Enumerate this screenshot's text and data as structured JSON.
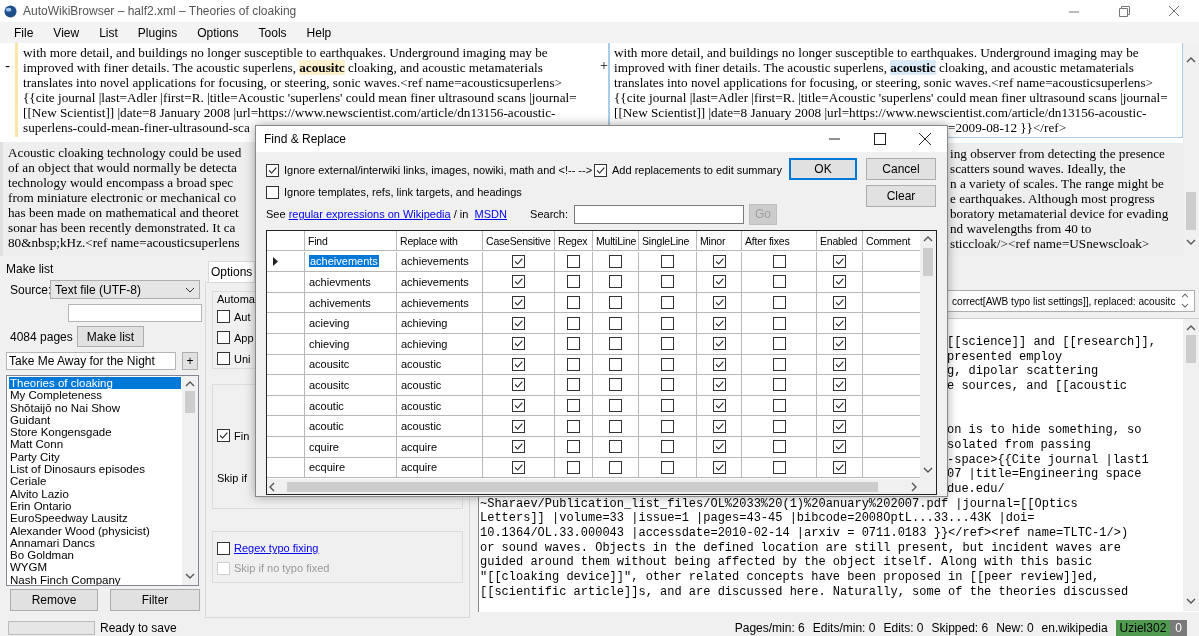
{
  "window": {
    "title": "AutoWikiBrowser – half2.xml – Theories of cloaking"
  },
  "menu": [
    "File",
    "View",
    "List",
    "Plugins",
    "Options",
    "Tools",
    "Help"
  ],
  "diff": {
    "columns": [
      {
        "kind": "removed",
        "marker": "-",
        "changed": {
          "lines": [
            "with more detail, and buildings no longer susceptible to earthquakes. Underground imaging may be",
            "improved with finer details. The acoustic superlens, **acousitc** cloaking, and acoustic metamaterials",
            "translates into novel applications for focusing, or steering, sonic waves.<ref name=acousticsuperlens>",
            "{{cite journal |last=Adler |first=R. |title=Acoustic 'superlens' could mean finer ultrasound scans |journal=",
            "[[New Scientist]] |date=8 January 2008 |url=https://www.newscientist.com/article/dn13156-acoustic-",
            "superlens-could-mean-finer-ultrasound-sca"
          ]
        },
        "context": {
          "lines": [
            "Acoustic cloaking technology could be used",
            "of an object that would normally be detecta",
            "technology would encompass a broad spec",
            "from miniature electronic or mechanical co",
            "has been made on mathematical and theoret",
            "sonar has been recently demonstrated. It ca",
            "80&nbsp;kHz.<ref name=acousticsuperlens"
          ]
        }
      },
      {
        "kind": "added",
        "marker": "+",
        "changed": {
          "lines": [
            "with more detail, and buildings no longer susceptible to earthquakes. Underground imaging may be",
            "improved with finer details. The acoustic superlens, **acoustic** cloaking, and acoustic metamaterials",
            "translates into novel applications for focusing, or steering, sonic waves.<ref name=acousticsuperlens>",
            "{{cite journal |last=Adler |first=R. |title=Acoustic 'superlens' could mean finer ultrasound scans |journal=",
            "[[New Scientist]] |date=8 January 2008 |url=https://www.newscientist.com/article/dn13156-acoustic-"
          ],
          "tail_lines": [
            "=2009-08-12 }}</ref>"
          ]
        },
        "context": {
          "tail_lines": [
            "ing observer from detecting the presence",
            "scatters sound waves. Ideally, the",
            "n a variety of scales. The range might be",
            "e earthquakes. Although most progress",
            "boratory metamaterial device for evading",
            "nd wavelengths from 40 to",
            "sticcloak/><ref name=USnewscloak>"
          ]
        }
      }
    ]
  },
  "make_list": {
    "title": "Make list",
    "source_label": "Source:",
    "source": "Text file (UTF-8)",
    "page_count": "4084 pages",
    "make_button": "Make list",
    "entry": "Take Me Away for the Night",
    "add_button": "+",
    "pages": [
      {
        "title": "Theories of cloaking",
        "selected": true
      },
      {
        "title": "My Completeness",
        "selected": false
      },
      {
        "title": "Shōtaijō no Nai Show",
        "selected": false
      },
      {
        "title": "Guidant",
        "selected": false
      },
      {
        "title": "Store Kongensgade",
        "selected": false
      },
      {
        "title": "Matt Conn",
        "selected": false
      },
      {
        "title": "Party City",
        "selected": false
      },
      {
        "title": "List of Dinosaurs episodes",
        "selected": false
      },
      {
        "title": "Ceriale",
        "selected": false
      },
      {
        "title": "Alvito Lazio",
        "selected": false
      },
      {
        "title": "Erin Ontario",
        "selected": false
      },
      {
        "title": "EuroSpeedway Lausitz",
        "selected": false
      },
      {
        "title": "Alexander Wood (physicist)",
        "selected": false
      },
      {
        "title": "Annamari Dancs",
        "selected": false
      },
      {
        "title": "Bo Goldman",
        "selected": false
      },
      {
        "title": "WYGM",
        "selected": false
      },
      {
        "title": "Nash Finch Company",
        "selected": false
      }
    ],
    "remove_button": "Remove",
    "filter_button": "Filter"
  },
  "options": {
    "tab": "Options",
    "group_title": "Automa",
    "auto_items": [
      {
        "label": "Aut",
        "checked": false
      },
      {
        "label": "App",
        "checked": false
      },
      {
        "label": "Uni",
        "checked": false
      }
    ],
    "find_item": {
      "label": "Fin",
      "checked": true
    },
    "skip_label": "Skip if",
    "typo_items": [
      {
        "label": "Regex typo fixing",
        "kind": "link",
        "checked": false,
        "disabled": false
      },
      {
        "label": "Skip if no typo fixed",
        "kind": "plain",
        "checked": false,
        "disabled": true
      }
    ]
  },
  "edit_summary": {
    "value": "correct[AWB typo list settings]], replaced: acousitc"
  },
  "editor": {
    "tail_blocks": [
      [
        "[[science]] and [[research]],",
        "presented employ",
        "g, dipolar scattering",
        "e sources, and [[acoustic"
      ],
      [
        "on is to hide something, so",
        "solated from passing",
        "-space>{{Cite journal |last1",
        "07 |title=Engineering space",
        "due.edu/"
      ]
    ],
    "lines": [
      "~Sharaev/Publication_list_files/OL%2033%20(1)%20anuary%202007.pdf |journal=[[Optics",
      "Letters]] |volume=33 |issue=1 |pages=43-45 |bibcode=2008OptL...33...43K |doi=",
      "10.1364/OL.33.000043 |accessdate=2010-02-14 |arxiv = 0711.0183 }}</ref><ref name=TLTC-1/>)",
      "or sound waves. Objects in the defined location are still present, but incident waves are",
      "guided around them without being affected by the object itself. Along with this basic",
      "\"[[cloaking device]]\", other related concepts have been proposed in [[peer review]]ed,",
      "[[scientific article]]s, and are discussed here. Naturally, some of the theories discussed"
    ]
  },
  "status_bar": {
    "message": "Ready to save",
    "stats": [
      "Pages/min: 6",
      "Edits/min: 0",
      "Edits: 0",
      "Skipped: 6",
      "New: 0",
      "en.wikipedia"
    ],
    "user": "Uziel302",
    "notifications": "0"
  },
  "dialog": {
    "title": "Find & Replace",
    "options": [
      {
        "label": "Ignore external/interwiki links, images, nowiki, math and <!-- -->",
        "checked": true
      },
      {
        "label": "Add replacements to edit summary",
        "checked": true
      },
      {
        "label": "Ignore templates, refs, link targets, and headings",
        "checked": false
      }
    ],
    "ok_button": "OK",
    "cancel_button": "Cancel",
    "clear_button": "Clear",
    "see_text": "See",
    "wiki_link": "regular expressions on Wikipedia",
    "in_text": "/ in",
    "msdn_link": "MSDN",
    "search_label": "Search:",
    "go_button": {
      "label": "Go",
      "disabled": true
    },
    "table": {
      "columns": [
        "Find",
        "Replace with",
        "CaseSensitive",
        "Regex",
        "MultiLine",
        "SingleLine",
        "Minor",
        "After fixes",
        "Enabled",
        "Comment"
      ],
      "rows": [
        {
          "selected": true,
          "find": "acheivements",
          "replace": "achievements",
          "case_sensitive": true,
          "regex": false,
          "multiline": false,
          "singleline": false,
          "minor": true,
          "after_fixes": false,
          "enabled": true
        },
        {
          "selected": false,
          "find": "achievments",
          "replace": "achievements",
          "case_sensitive": true,
          "regex": false,
          "multiline": false,
          "singleline": false,
          "minor": true,
          "after_fixes": false,
          "enabled": true
        },
        {
          "selected": false,
          "find": "achivements",
          "replace": "achievements",
          "case_sensitive": true,
          "regex": false,
          "multiline": false,
          "singleline": false,
          "minor": true,
          "after_fixes": false,
          "enabled": true
        },
        {
          "selected": false,
          "find": "acieving",
          "replace": "achieving",
          "case_sensitive": true,
          "regex": false,
          "multiline": false,
          "singleline": false,
          "minor": true,
          "after_fixes": false,
          "enabled": true
        },
        {
          "selected": false,
          "find": "chieving",
          "replace": "achieving",
          "case_sensitive": true,
          "regex": false,
          "multiline": false,
          "singleline": false,
          "minor": true,
          "after_fixes": false,
          "enabled": true
        },
        {
          "selected": false,
          "find": "acousitc",
          "replace": "acoustic",
          "case_sensitive": true,
          "regex": false,
          "multiline": false,
          "singleline": false,
          "minor": true,
          "after_fixes": false,
          "enabled": true
        },
        {
          "selected": false,
          "find": "acousitc",
          "replace": "acoustic",
          "case_sensitive": true,
          "regex": false,
          "multiline": false,
          "singleline": false,
          "minor": true,
          "after_fixes": false,
          "enabled": true
        },
        {
          "selected": false,
          "find": "acoutic",
          "replace": "acoustic",
          "case_sensitive": true,
          "regex": false,
          "multiline": false,
          "singleline": false,
          "minor": true,
          "after_fixes": false,
          "enabled": true
        },
        {
          "selected": false,
          "find": "acoutic",
          "replace": "acoustic",
          "case_sensitive": true,
          "regex": false,
          "multiline": false,
          "singleline": false,
          "minor": true,
          "after_fixes": false,
          "enabled": true
        },
        {
          "selected": false,
          "find": "cquire",
          "replace": "acquire",
          "case_sensitive": true,
          "regex": false,
          "multiline": false,
          "singleline": false,
          "minor": true,
          "after_fixes": false,
          "enabled": true
        },
        {
          "selected": false,
          "find": "ecquire",
          "replace": "acquire",
          "case_sensitive": true,
          "regex": false,
          "multiline": false,
          "singleline": false,
          "minor": true,
          "after_fixes": false,
          "enabled": true
        }
      ]
    }
  }
}
